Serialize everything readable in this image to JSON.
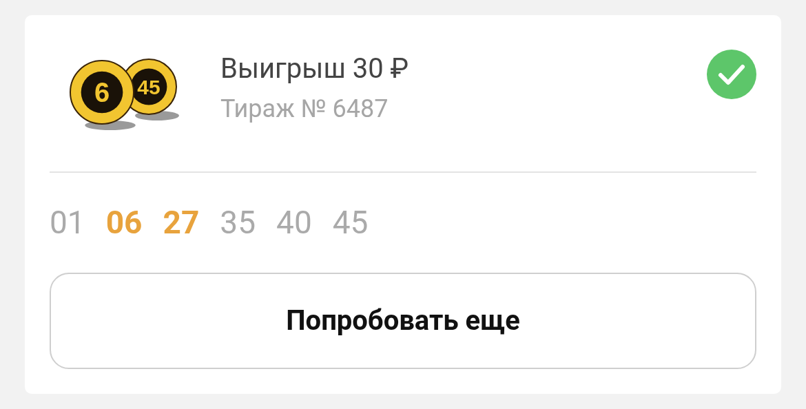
{
  "ticket": {
    "logo_balls": [
      "6",
      "45"
    ],
    "title": "Выигрыш 30 ₽",
    "subtitle": "Тираж № 6487",
    "checked": true,
    "numbers": [
      {
        "text": "01",
        "matched": false
      },
      {
        "text": "06",
        "matched": true
      },
      {
        "text": "27",
        "matched": true
      },
      {
        "text": "35",
        "matched": false
      },
      {
        "text": "40",
        "matched": false
      },
      {
        "text": "45",
        "matched": false
      }
    ],
    "button": "Попробовать еще"
  }
}
